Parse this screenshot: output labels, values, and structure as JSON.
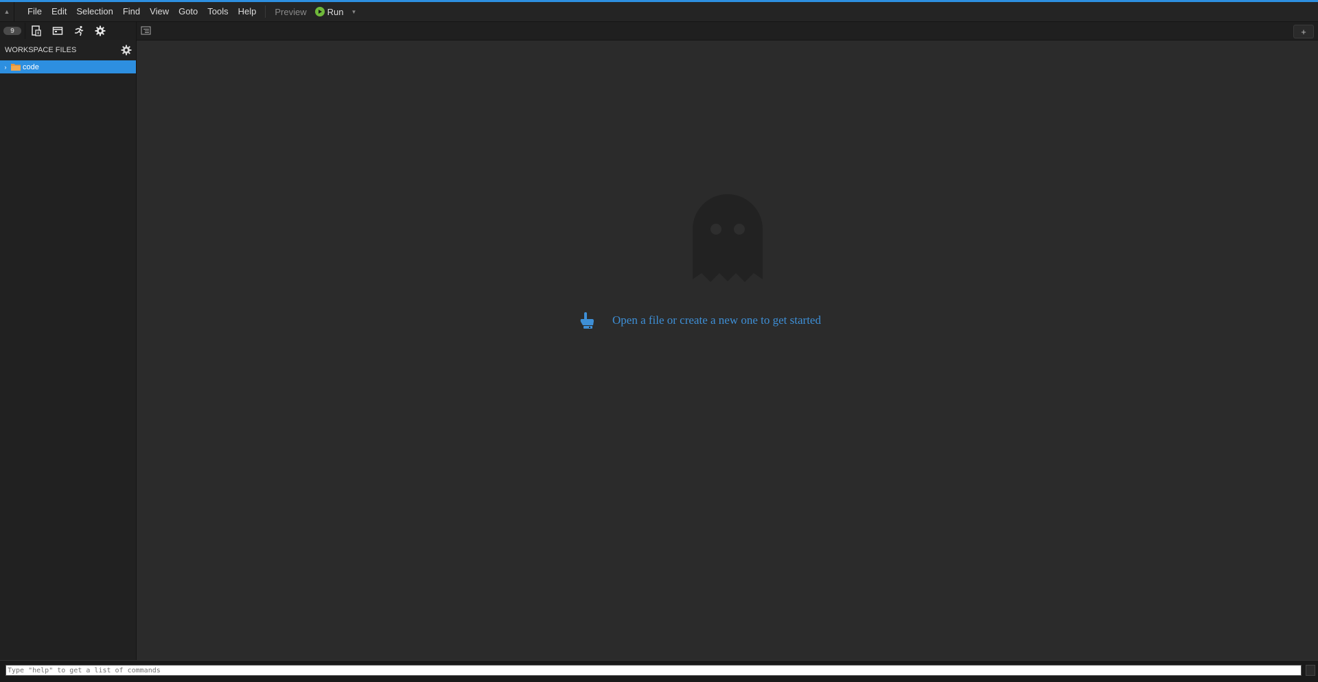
{
  "menubar": {
    "items": [
      "File",
      "Edit",
      "Selection",
      "Find",
      "View",
      "Goto",
      "Tools",
      "Help"
    ],
    "preview_label": "Preview",
    "run_label": "Run"
  },
  "toolbar": {
    "logo_label": "9"
  },
  "tabbar": {
    "add_label": "+"
  },
  "sidebar": {
    "title": "WORKSPACE FILES",
    "tree": [
      {
        "label": "code",
        "type": "folder",
        "selected": true
      }
    ]
  },
  "editor": {
    "empty_hint": "Open a file or create a new one to get started"
  },
  "commandbar": {
    "placeholder": "Type \"help\" to get a list of commands"
  },
  "colors": {
    "accent": "#2d8fe0",
    "hint": "#3e8fd6",
    "run": "#6fb83a",
    "folder": "#e8943a"
  }
}
